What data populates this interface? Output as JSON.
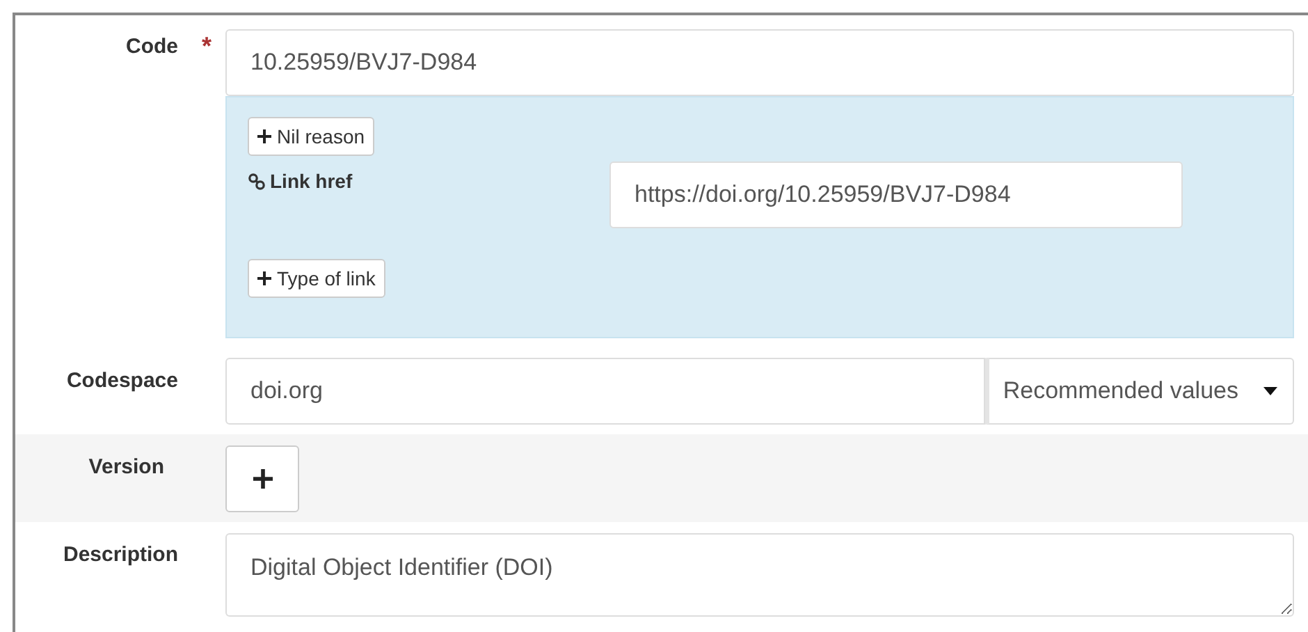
{
  "code": {
    "label": "Code",
    "required_mark": "*",
    "value": "10.25959/BVJ7-D984",
    "nil_reason_button": "Nil reason",
    "link_href": {
      "label": "Link href",
      "value": "https://doi.org/10.25959/BVJ7-D984"
    },
    "type_of_link_button": "Type of link"
  },
  "codespace": {
    "label": "Codespace",
    "value": "doi.org",
    "dropdown": "Recommended values"
  },
  "version": {
    "label": "Version"
  },
  "description": {
    "label": "Description",
    "value": "Digital Object Identifier (DOI)"
  }
}
